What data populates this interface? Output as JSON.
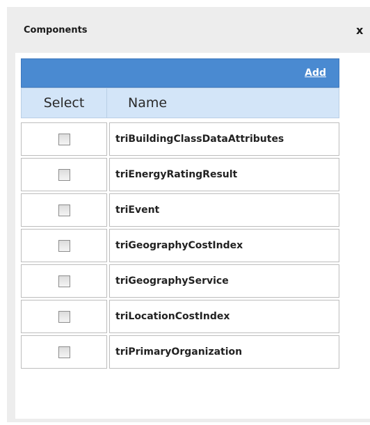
{
  "dialog": {
    "title": "Components",
    "close_label": "x"
  },
  "toolbar": {
    "add_label": "Add"
  },
  "table": {
    "columns": [
      "Select",
      "Name"
    ],
    "rows": [
      {
        "name": "triBuildingClassDataAttributes",
        "checked": false
      },
      {
        "name": "triEnergyRatingResult",
        "checked": false
      },
      {
        "name": "triEvent",
        "checked": false
      },
      {
        "name": "triGeographyCostIndex",
        "checked": false
      },
      {
        "name": "triGeographyService",
        "checked": false
      },
      {
        "name": "triLocationCostIndex",
        "checked": false
      },
      {
        "name": "triPrimaryOrganization",
        "checked": false
      }
    ]
  },
  "colors": {
    "toolbar": "#4a8ad1",
    "header": "#d3e5f8",
    "dialog_background": "#ededed"
  }
}
